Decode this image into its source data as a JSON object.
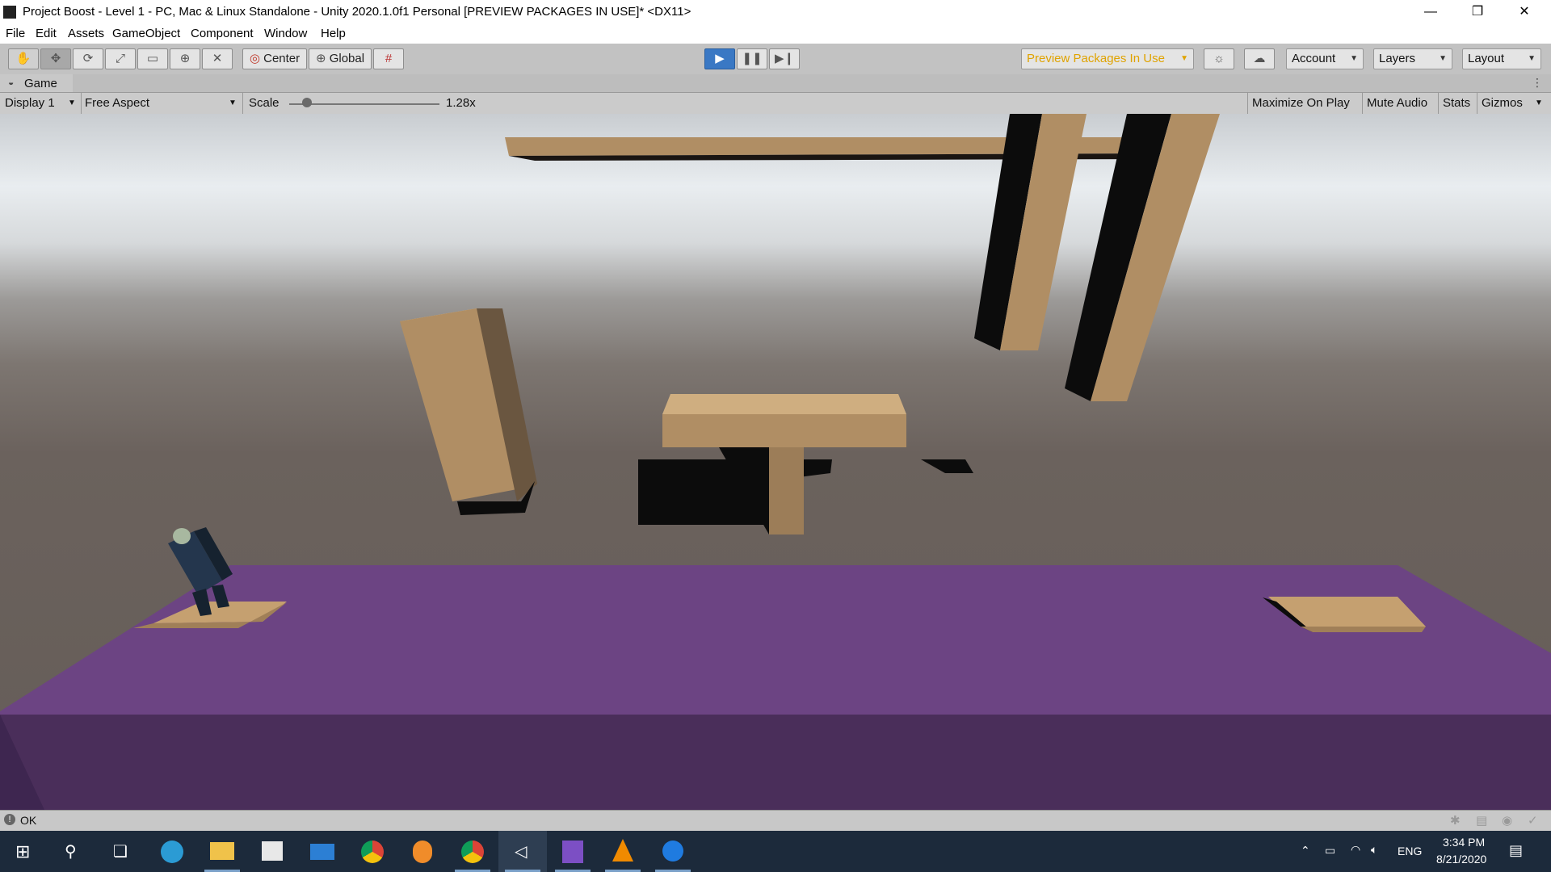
{
  "window": {
    "title": "Project Boost - Level 1 - PC, Mac & Linux Standalone - Unity 2020.1.0f1 Personal [PREVIEW PACKAGES IN USE]* <DX11>",
    "minimize": "—",
    "restore": "❐",
    "close": "✕"
  },
  "menu": [
    "File",
    "Edit",
    "Assets",
    "GameObject",
    "Component",
    "Window",
    "Help"
  ],
  "toolbar": {
    "tools": [
      "hand-tool",
      "move-tool",
      "rotate-tool",
      "scale-tool",
      "rect-tool",
      "transform-tool",
      "custom-tool"
    ],
    "center_label": "Center",
    "global_label": "Global",
    "preview_packages_label": "Preview Packages In Use",
    "account_label": "Account",
    "layers_label": "Layers",
    "layout_label": "Layout",
    "preview_color": "#e0a300"
  },
  "game_tab": {
    "label": "Game"
  },
  "game_controls": {
    "display": "Display 1",
    "aspect": "Free Aspect",
    "scale_label": "Scale",
    "scale_value": "1.28x",
    "scale_fraction": 0.12,
    "maximize": "Maximize On Play",
    "mute": "Mute Audio",
    "stats": "Stats",
    "gizmos": "Gizmos"
  },
  "status": {
    "text": "OK"
  },
  "taskbar": {
    "apps": [
      "start-icon",
      "search-icon",
      "task-view-icon",
      "edge-icon",
      "file-explorer-icon",
      "store-icon",
      "mail-icon",
      "chrome-icon",
      "fl-studio-icon",
      "chrome-alt-icon",
      "unity-icon",
      "visual-studio-icon",
      "vlc-icon",
      "maps-icon"
    ],
    "language": "ENG",
    "time": "3:34 PM",
    "date": "8/21/2020"
  },
  "colors": {
    "platform_top": "#6c4483",
    "platform_side": "#4a2e5a",
    "wood": "#b08e64",
    "wood_dark": "#6a5640",
    "rocket": "#24364d"
  }
}
